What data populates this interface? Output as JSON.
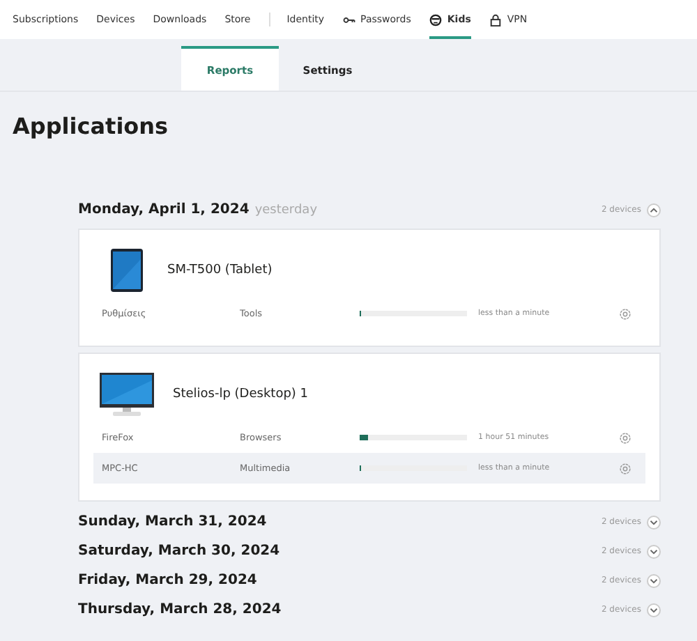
{
  "nav": {
    "items": [
      {
        "label": "Subscriptions",
        "selected": false
      },
      {
        "label": "Devices",
        "selected": false
      },
      {
        "label": "Downloads",
        "selected": false
      },
      {
        "label": "Store",
        "selected": false
      },
      {
        "label": "Identity",
        "selected": false
      },
      {
        "label": "Passwords",
        "selected": false
      },
      {
        "label": "Kids",
        "selected": true
      },
      {
        "label": "VPN",
        "selected": false
      }
    ]
  },
  "subtabs": [
    {
      "label": "Reports",
      "selected": true
    },
    {
      "label": "Settings",
      "selected": false
    }
  ],
  "page_title": "Applications",
  "days": [
    {
      "date": "Monday, April 1, 2024",
      "note": "yesterday",
      "count": "2 devices",
      "expanded": true,
      "devices": [
        {
          "name": "SM-T500 (Tablet)",
          "kind": "tablet",
          "apps": [
            {
              "name": "Ρυθμίσεις",
              "category": "Tools",
              "level": 0.01,
              "reading": "less than a minute",
              "highlighted": false
            }
          ]
        },
        {
          "name": "Stelios-lp (Desktop) 1",
          "kind": "desktop",
          "apps": [
            {
              "name": "FireFox",
              "category": "Browsers",
              "level": 0.08,
              "reading": "1 hour 51 minutes",
              "highlighted": false
            },
            {
              "name": "MPC-HC",
              "category": "Multimedia",
              "level": 0.01,
              "reading": "less than a minute",
              "highlighted": true
            }
          ]
        }
      ]
    },
    {
      "date": "Sunday, March 31, 2024",
      "count": "2 devices",
      "expanded": false
    },
    {
      "date": "Saturday, March 30, 2024",
      "count": "2 devices",
      "expanded": false
    },
    {
      "date": "Friday, March 29, 2024",
      "count": "2 devices",
      "expanded": false
    },
    {
      "date": "Thursday, March 28, 2024",
      "count": "2 devices",
      "expanded": false
    }
  ]
}
